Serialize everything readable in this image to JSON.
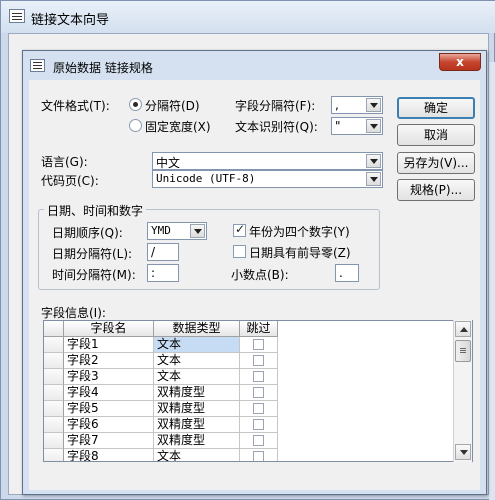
{
  "outer_window": {
    "title": "链接文本向导"
  },
  "dialog": {
    "title": "原始数据 链接规格",
    "close_glyph": "x"
  },
  "format": {
    "label": "文件格式(T):",
    "options": [
      {
        "label": "分隔符(D)",
        "selected": true
      },
      {
        "label": "固定宽度(X)",
        "selected": false
      }
    ]
  },
  "field_delimiter": {
    "label": "字段分隔符(F):",
    "value": ","
  },
  "text_qualifier": {
    "label": "文本识别符(Q):",
    "value": "\""
  },
  "language": {
    "label": "语言(G):",
    "value": "中文"
  },
  "code_page": {
    "label": "代码页(C):",
    "value": "Unicode (UTF-8)"
  },
  "datetime_group": {
    "title": "日期、时间和数字",
    "date_order": {
      "label": "日期顺序(Q):",
      "value": "YMD"
    },
    "date_separator": {
      "label": "日期分隔符(L):",
      "value": "/"
    },
    "time_separator": {
      "label": "时间分隔符(M):",
      "value": ":"
    },
    "four_digit_years": {
      "label": "年份为四个数字(Y)",
      "checked": true
    },
    "leading_zeros": {
      "label": "日期具有前导零(Z)",
      "checked": false
    },
    "decimal_symbol": {
      "label": "小数点(B):",
      "value": "."
    }
  },
  "buttons": {
    "ok": "确定",
    "cancel": "取消",
    "save_as": "另存为(V)...",
    "specs": "规格(P)..."
  },
  "fields_info": {
    "label": "字段信息(I):",
    "columns": [
      "字段名",
      "数据类型",
      "跳过"
    ],
    "rows": [
      {
        "name": "字段1",
        "type": "文本",
        "skip": false
      },
      {
        "name": "字段2",
        "type": "文本",
        "skip": false
      },
      {
        "name": "字段3",
        "type": "文本",
        "skip": false
      },
      {
        "name": "字段4",
        "type": "双精度型",
        "skip": false
      },
      {
        "name": "字段5",
        "type": "双精度型",
        "skip": false
      },
      {
        "name": "字段6",
        "type": "双精度型",
        "skip": false
      },
      {
        "name": "字段7",
        "type": "双精度型",
        "skip": false
      },
      {
        "name": "字段8",
        "type": "文本",
        "skip": false
      }
    ]
  },
  "colors": {
    "title_close": "#c7452f",
    "default_button_border": "#3c7fb1",
    "selected_cell": "#c6dcf5"
  }
}
